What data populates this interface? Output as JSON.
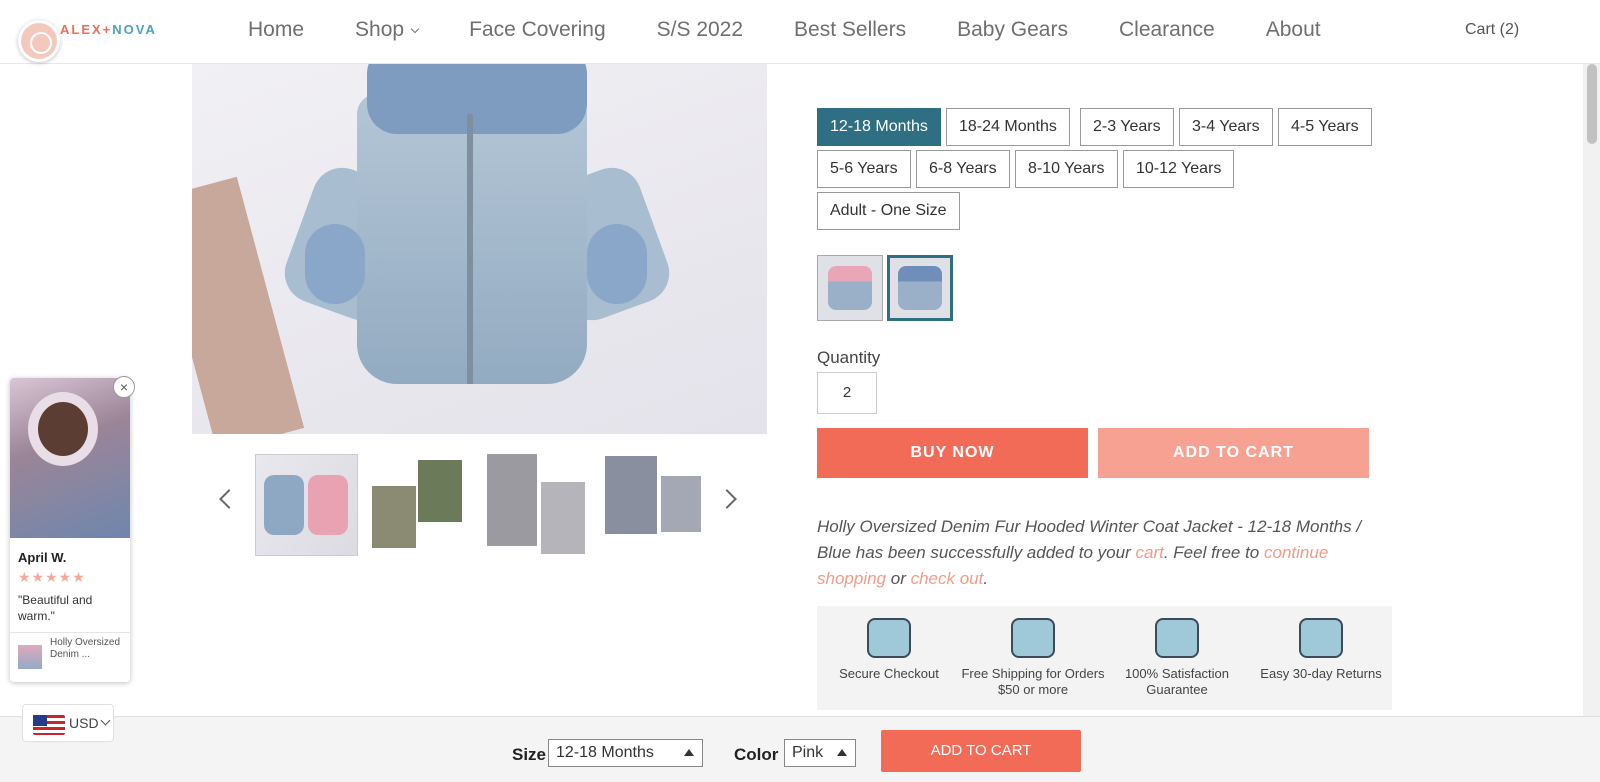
{
  "brand": {
    "logo_part1": "ALEX",
    "logo_sep": "+",
    "logo_part2": "NOVA"
  },
  "nav": {
    "items": [
      "Home",
      "Shop",
      "Face Covering",
      "S/S 2022",
      "Best Sellers",
      "Baby Gears",
      "Clearance",
      "About"
    ],
    "cart": "Cart (2)"
  },
  "product": {
    "sizes": [
      "12-18 Months",
      "18-24 Months",
      "2-3 Years",
      "3-4 Years",
      "4-5 Years",
      "5-6 Years",
      "6-8 Years",
      "8-10 Years",
      "10-12 Years",
      "Adult - One Size"
    ],
    "selected_size": "12-18 Months",
    "color_swatches": [
      "Pink",
      "Blue"
    ],
    "selected_color_swatch": "Blue",
    "quantity_label": "Quantity",
    "quantity": "2",
    "buy_now": "BUY NOW",
    "add_to_cart": "ADD TO CART",
    "message": {
      "prefix": "Holly Oversized Denim Fur Hooded Winter Coat Jacket - 12-18 Months / Blue has been successfully added to your ",
      "cart_link": "cart",
      "middle": ". Feel free to ",
      "continue_link": "continue shopping",
      "or": " or ",
      "checkout_link": "check out",
      "suffix": "."
    }
  },
  "trust": [
    {
      "icon": "lock-icon",
      "label": "Secure Checkout"
    },
    {
      "icon": "truck-icon",
      "label": "Free Shipping for Orders $50 or more"
    },
    {
      "icon": "thumbs-up-icon",
      "label": "100% Satisfaction Guarantee"
    },
    {
      "icon": "calendar-return-icon",
      "label": "Easy 30-day Returns"
    }
  ],
  "review": {
    "name": "April W.",
    "stars": "★★★★★",
    "text": "\"Beautiful and warm.\"",
    "product": "Holly Oversized Denim ...",
    "close": "×"
  },
  "currency": {
    "value": "USD"
  },
  "bottom_bar": {
    "size_label": "Size",
    "size_value": "12-18 Months",
    "color_label": "Color",
    "color_value": "Pink",
    "add_to_cart": "ADD TO CART"
  },
  "colors": {
    "accent": "#f26b57",
    "accent_light": "#f7a193",
    "selected": "#2f6f83",
    "link": "#f29b86"
  }
}
